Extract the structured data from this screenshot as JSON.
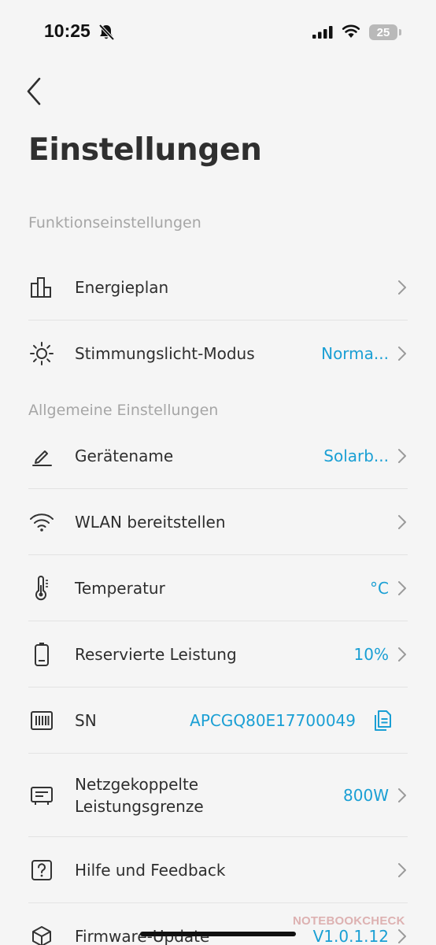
{
  "status_bar": {
    "time": "10:25",
    "battery_level": "25"
  },
  "header": {
    "title": "Einstellungen"
  },
  "sections": {
    "function_settings": "Funktionseinstellungen",
    "general_settings": "Allgemeine Einstellungen"
  },
  "rows": {
    "energy_plan": {
      "label": "Energieplan",
      "icon": "bar-chart-icon"
    },
    "mood_light": {
      "label": "Stimmungslicht-Modus",
      "value": "Norma...",
      "icon": "sun-icon"
    },
    "device_name": {
      "label": "Gerätename",
      "value": "Solarb...",
      "icon": "pencil-icon"
    },
    "wlan": {
      "label": "WLAN bereitstellen",
      "icon": "wifi-icon"
    },
    "temperature": {
      "label": "Temperatur",
      "value": "°C",
      "icon": "thermometer-icon"
    },
    "reserved_power": {
      "label": "Reservierte Leistung",
      "value": "10%",
      "icon": "battery-icon"
    },
    "serial_number": {
      "label": "SN",
      "value": "APCGQ80E17700049",
      "icon": "barcode-icon"
    },
    "grid_limit": {
      "label_line1": "Netzgekoppelte",
      "label_line2": "Leistungsgrenze",
      "value": "800W",
      "icon": "inverter-icon"
    },
    "help": {
      "label": "Hilfe und Feedback",
      "icon": "help-icon"
    },
    "firmware": {
      "label": "Firmware-Update",
      "value": "V1.0.1.12",
      "icon": "cube-icon"
    }
  },
  "watermark": "NOTEBOOKCHECK",
  "colors": {
    "accent": "#1a9fd4",
    "background": "#f5f5f5",
    "text": "#2e2e2e",
    "section_header": "#a6a6a6"
  }
}
